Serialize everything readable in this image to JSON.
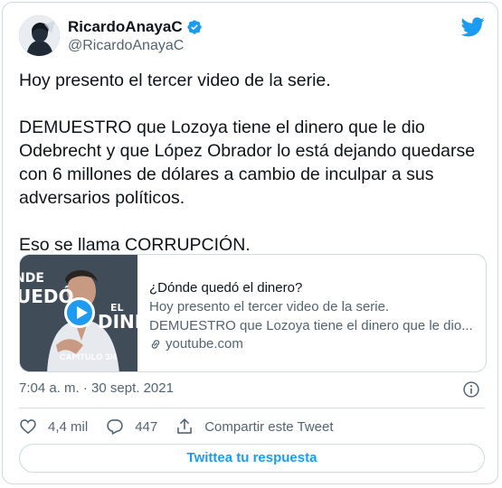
{
  "author": {
    "display_name": "RicardoAnayaC",
    "handle": "@RicardoAnayaC",
    "verified": true
  },
  "tweet": {
    "text": "Hoy presento el tercer video de la serie.\n\nDEMUESTRO que Lozoya tiene el dinero que le dio Odebrecht y que López Obrador lo está dejando quedarse con 6 millones de dólares a cambio de inculpar a sus adversarios políticos.\n\nEso se llama CORRUPCIÓN."
  },
  "link_card": {
    "title": "¿Dónde quedó el dinero?",
    "description_line1": "Hoy presento el tercer video de la serie.",
    "description_line2": "DEMUESTRO que Lozoya tiene el dinero que le dio...",
    "domain": "youtube.com",
    "thumbnail_text": {
      "top": "NDE",
      "middle": "UEDÓ",
      "right_small": "EL",
      "right_big": "DINE",
      "caption": "CAPITULO 3/4"
    }
  },
  "meta": {
    "timestamp": "7:04 a. m. · 30 sept. 2021"
  },
  "actions": {
    "likes": "4,4 mil",
    "replies": "447",
    "share_label": "Compartir este Tweet"
  },
  "reply_button": {
    "label": "Twittea tu respuesta"
  },
  "colors": {
    "accent": "#1d9bf0",
    "text": "#0f1419",
    "secondary": "#536471",
    "border": "#cfd9de"
  },
  "icons": [
    "avatar",
    "verified-badge-icon",
    "twitter-bird-icon",
    "play-icon",
    "link-icon",
    "info-icon",
    "heart-icon",
    "reply-icon",
    "share-icon"
  ]
}
